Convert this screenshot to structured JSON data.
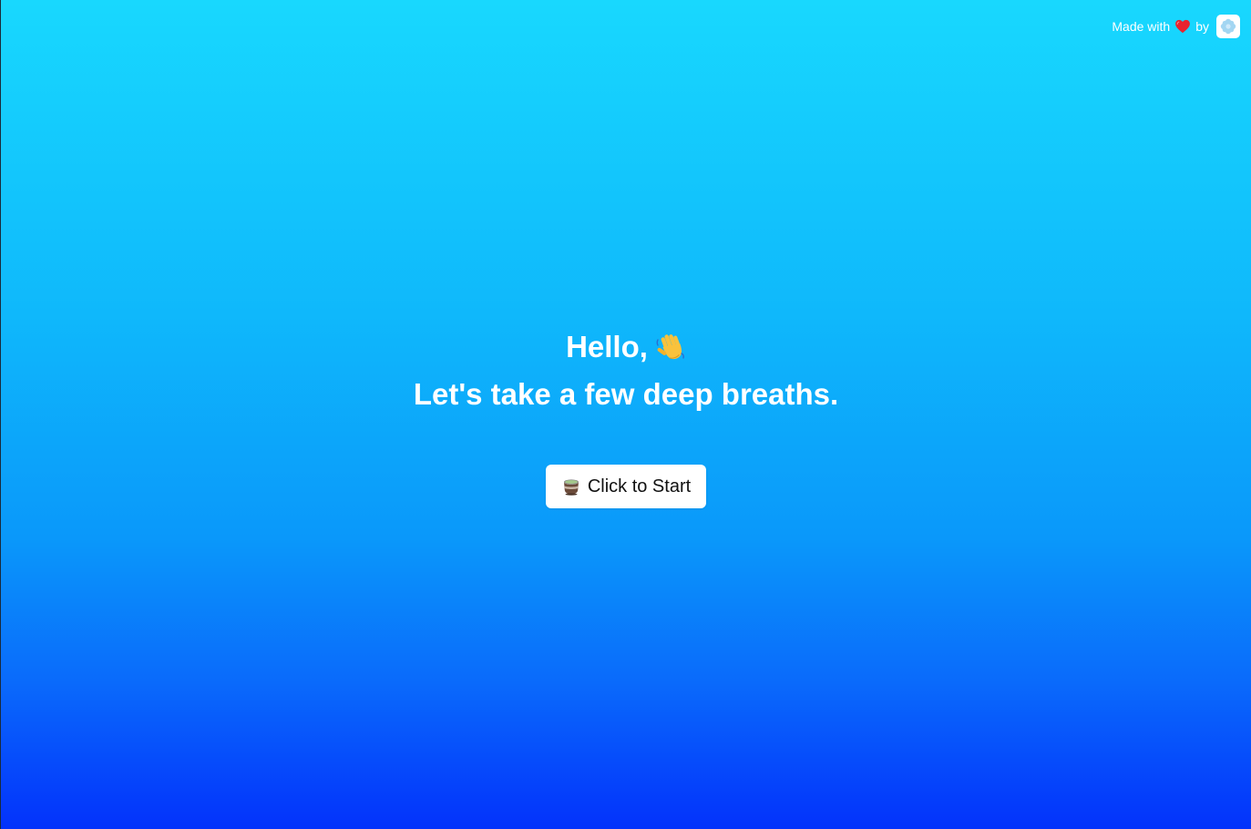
{
  "credit": {
    "prefix": "Made with",
    "suffix": "by",
    "heart_icon": "heart-icon",
    "logo_icon": "flower-logo-icon"
  },
  "main": {
    "greeting": "Hello,",
    "greeting_icon": "waving-hand-icon",
    "subtitle": "Let's take a few deep breaths.",
    "start_button": {
      "icon": "tea-cup-icon",
      "label": "Click to Start"
    }
  },
  "colors": {
    "gradient_top": "#18d8fe",
    "gradient_bottom": "#0332fb",
    "button_bg": "#ffffff",
    "heart": "#e8222e"
  }
}
